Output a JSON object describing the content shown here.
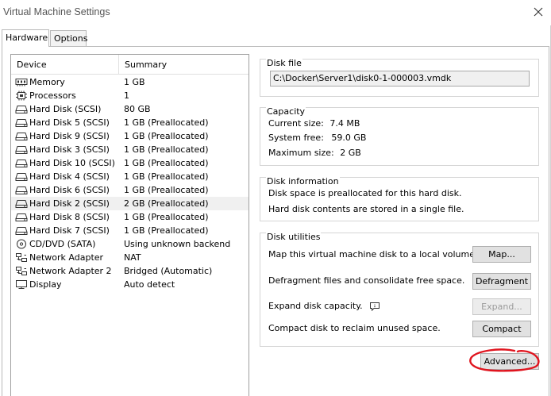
{
  "window": {
    "title": "Virtual Machine Settings"
  },
  "tabs": [
    {
      "label": "Hardware",
      "active": true
    },
    {
      "label": "Options",
      "active": false
    }
  ],
  "device_list": {
    "headers": {
      "device": "Device",
      "summary": "Summary"
    },
    "rows": [
      {
        "icon": "memory-icon",
        "device": "Memory",
        "summary": "1 GB"
      },
      {
        "icon": "processor-icon",
        "device": "Processors",
        "summary": "1"
      },
      {
        "icon": "hard-disk-icon",
        "device": "Hard Disk (SCSI)",
        "summary": "80 GB"
      },
      {
        "icon": "hard-disk-icon",
        "device": "Hard Disk 5 (SCSI)",
        "summary": "1 GB (Preallocated)"
      },
      {
        "icon": "hard-disk-icon",
        "device": "Hard Disk 9 (SCSI)",
        "summary": "1 GB (Preallocated)"
      },
      {
        "icon": "hard-disk-icon",
        "device": "Hard Disk 3 (SCSI)",
        "summary": "1 GB (Preallocated)"
      },
      {
        "icon": "hard-disk-icon",
        "device": "Hard Disk 10 (SCSI)",
        "summary": "1 GB (Preallocated)"
      },
      {
        "icon": "hard-disk-icon",
        "device": "Hard Disk 4 (SCSI)",
        "summary": "1 GB (Preallocated)"
      },
      {
        "icon": "hard-disk-icon",
        "device": "Hard Disk 6 (SCSI)",
        "summary": "1 GB (Preallocated)"
      },
      {
        "icon": "hard-disk-icon",
        "device": "Hard Disk 2 (SCSI)",
        "summary": "2 GB (Preallocated)",
        "selected": true
      },
      {
        "icon": "hard-disk-icon",
        "device": "Hard Disk 8 (SCSI)",
        "summary": "1 GB (Preallocated)"
      },
      {
        "icon": "hard-disk-icon",
        "device": "Hard Disk 7 (SCSI)",
        "summary": "1 GB (Preallocated)"
      },
      {
        "icon": "cd-dvd-icon",
        "device": "CD/DVD (SATA)",
        "summary": "Using unknown backend"
      },
      {
        "icon": "network-adapter-icon",
        "device": "Network Adapter",
        "summary": "NAT"
      },
      {
        "icon": "network-adapter-icon",
        "device": "Network Adapter 2",
        "summary": "Bridged (Automatic)"
      },
      {
        "icon": "display-icon",
        "device": "Display",
        "summary": "Auto detect"
      }
    ]
  },
  "disk_file": {
    "title": "Disk file",
    "path": "C:\\Docker\\Server1\\disk0-1-000003.vmdk"
  },
  "capacity": {
    "title": "Capacity",
    "current_size_label": "Current size:",
    "current_size_value": "7.4 MB",
    "system_free_label": "System free:",
    "system_free_value": "59.0 GB",
    "maximum_size_label": "Maximum size:",
    "maximum_size_value": "2 GB"
  },
  "disk_information": {
    "title": "Disk information",
    "line1": "Disk space is preallocated for this hard disk.",
    "line2": "Hard disk contents are stored in a single file."
  },
  "disk_utilities": {
    "title": "Disk utilities",
    "map_text": "Map this virtual machine disk to a local volume.",
    "map_button": "Map...",
    "defrag_text": "Defragment files and consolidate free space.",
    "defrag_button": "Defragment",
    "expand_text": "Expand disk capacity.",
    "expand_button": "Expand...",
    "compact_text": "Compact disk to reclaim unused space.",
    "compact_button": "Compact"
  },
  "advanced_button": "Advanced...",
  "colors": {
    "annotation": "#e0141e",
    "selected_row": "#f0f0f0",
    "button_face": "#e1e1e1"
  }
}
